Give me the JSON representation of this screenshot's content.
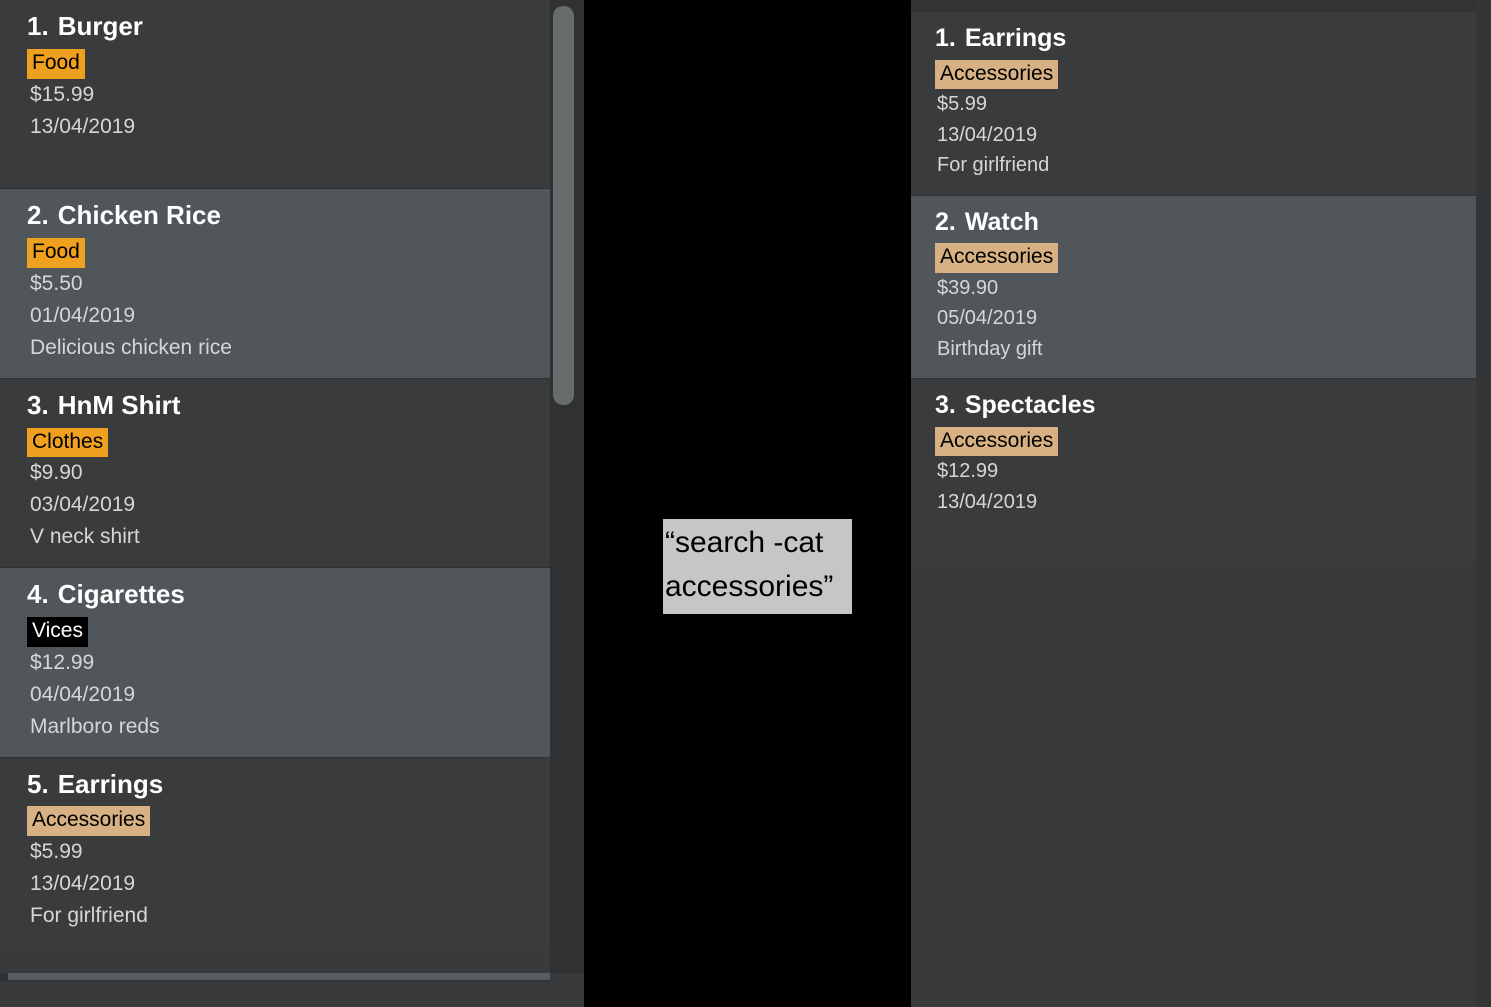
{
  "left_panel": {
    "name": "expense-list-all",
    "items": [
      {
        "index": "1.",
        "title": "Burger",
        "category": "Food",
        "category_key": "food",
        "price": "$15.99",
        "date": "13/04/2019",
        "note": "",
        "selected": false
      },
      {
        "index": "2.",
        "title": "Chicken Rice",
        "category": "Food",
        "category_key": "food",
        "price": "$5.50",
        "date": "01/04/2019",
        "note": "Delicious chicken rice",
        "selected": true
      },
      {
        "index": "3.",
        "title": "HnM Shirt",
        "category": "Clothes",
        "category_key": "clothes",
        "price": "$9.90",
        "date": "03/04/2019",
        "note": "V neck shirt",
        "selected": false
      },
      {
        "index": "4.",
        "title": "Cigarettes",
        "category": "Vices",
        "category_key": "vices",
        "price": "$12.99",
        "date": "04/04/2019",
        "note": "Marlboro reds",
        "selected": true
      },
      {
        "index": "5.",
        "title": "Earrings",
        "category": "Accessories",
        "category_key": "accessories",
        "price": "$5.99",
        "date": "13/04/2019",
        "note": "For girlfriend",
        "selected": false
      }
    ]
  },
  "right_panel": {
    "name": "expense-list-filtered",
    "items": [
      {
        "index": "1.",
        "title": "Earrings",
        "category": "Accessories",
        "category_key": "accessories",
        "price": "$5.99",
        "date": "13/04/2019",
        "note": "For girlfriend",
        "selected": false
      },
      {
        "index": "2.",
        "title": "Watch",
        "category": "Accessories",
        "category_key": "accessories",
        "price": "$39.90",
        "date": "05/04/2019",
        "note": "Birthday gift",
        "selected": true
      },
      {
        "index": "3.",
        "title": "Spectacles",
        "category": "Accessories",
        "category_key": "accessories",
        "price": "$12.99",
        "date": "13/04/2019",
        "note": "",
        "selected": false
      }
    ]
  },
  "callout": {
    "text": "“search -cat accessories”"
  },
  "colors": {
    "background": "#000000",
    "panel_bg": "#383a3b",
    "card_bg": "#393b3c",
    "card_bg_selected": "#51565a",
    "tag_food": "#efa01e",
    "tag_clothes": "#efa01e",
    "tag_vices": "#000000",
    "tag_accessories": "#d7b183",
    "title_text": "#ffffff",
    "body_text": "#d6d6d6",
    "scrollbar_thumb": "#686c6d",
    "callout_bg": "#c6c6c6"
  }
}
